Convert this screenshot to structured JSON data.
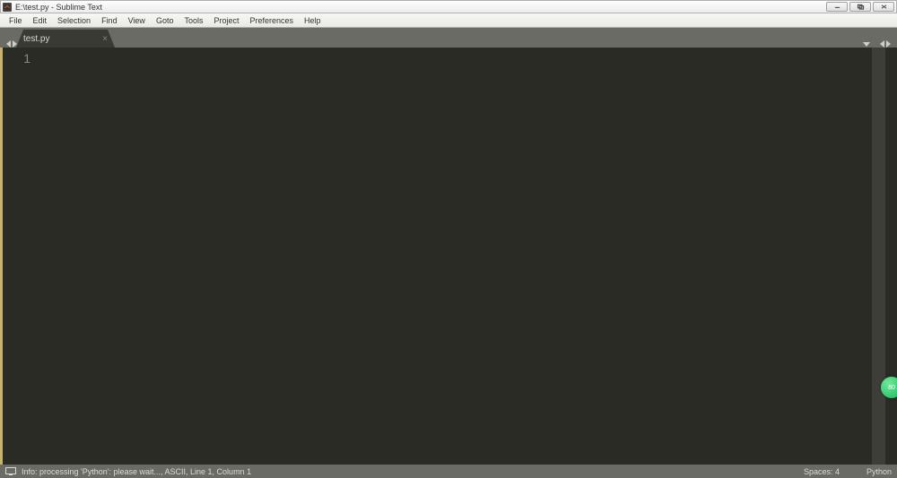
{
  "title": "E:\\test.py - Sublime Text",
  "menu": [
    "File",
    "Edit",
    "Selection",
    "Find",
    "View",
    "Goto",
    "Tools",
    "Project",
    "Preferences",
    "Help"
  ],
  "tabs": [
    {
      "label": "test.py",
      "close": "×"
    }
  ],
  "gutter_lines": [
    "1"
  ],
  "status": {
    "left": "Info: processing 'Python': please wait...,  ASCII, Line 1, Column 1",
    "right": {
      "spaces": "Spaces: 4",
      "lang": "Python"
    }
  },
  "badge": "80"
}
